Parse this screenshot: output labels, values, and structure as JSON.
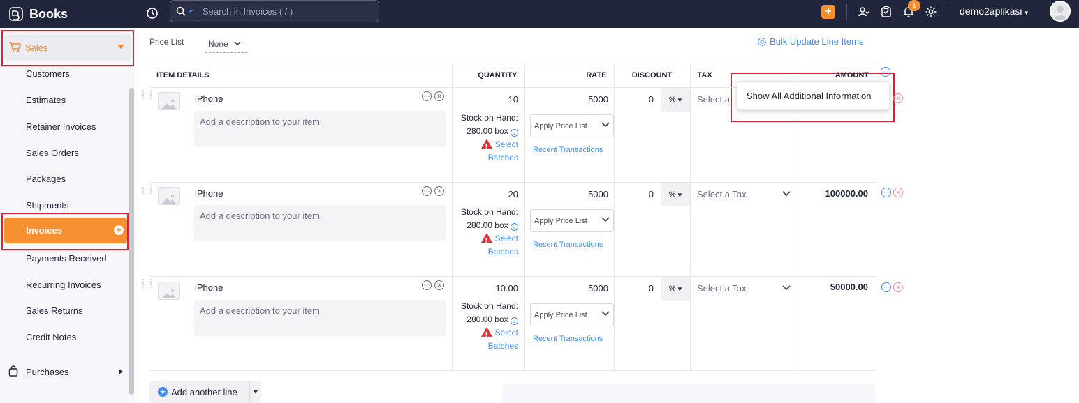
{
  "app": {
    "name": "Books"
  },
  "search": {
    "placeholder": "Search in Invoices ( / )"
  },
  "topbar": {
    "notification_count": "1",
    "org_name": "demo2aplikasi"
  },
  "sidebar": {
    "section": "Sales",
    "items": [
      "Customers",
      "Estimates",
      "Retainer Invoices",
      "Sales Orders",
      "Packages",
      "Shipments",
      "Invoices",
      "Payments Received",
      "Recurring Invoices",
      "Sales Returns",
      "Credit Notes"
    ],
    "active_item": "Invoices",
    "next_section": "Purchases"
  },
  "price_list": {
    "label": "Price List",
    "value": "None"
  },
  "bulk_update": {
    "label": "Bulk Update Line Items"
  },
  "table": {
    "headers": {
      "item": "ITEM DETAILS",
      "quantity": "QUANTITY",
      "rate": "RATE",
      "discount": "DISCOUNT",
      "tax": "TAX",
      "amount": "AMOUNT"
    }
  },
  "rows": [
    {
      "name": "iPhone",
      "description_placeholder": "Add a description to your item",
      "quantity": "10",
      "stock_label": "Stock on Hand:",
      "stock_value": "280.00 box",
      "select_batches": "Select Batches",
      "rate": "5000",
      "apply_price_list": "Apply Price List",
      "recent_transactions": "Recent Transactions",
      "discount": "0",
      "discount_unit": "%",
      "tax": "Select a Tax",
      "amount": ""
    },
    {
      "name": "iPhone",
      "description_placeholder": "Add a description to your item",
      "quantity": "20",
      "stock_label": "Stock on Hand:",
      "stock_value": "280.00 box",
      "select_batches": "Select Batches",
      "rate": "5000",
      "apply_price_list": "Apply Price List",
      "recent_transactions": "Recent Transactions",
      "discount": "0",
      "discount_unit": "%",
      "tax": "Select a Tax",
      "amount": "100000.00"
    },
    {
      "name": "iPhone",
      "description_placeholder": "Add a description to your item",
      "quantity": "10.00",
      "stock_label": "Stock on Hand:",
      "stock_value": "280.00 box",
      "select_batches": "Select Batches",
      "rate": "5000",
      "apply_price_list": "Apply Price List",
      "recent_transactions": "Recent Transactions",
      "discount": "0",
      "discount_unit": "%",
      "tax": "Select a Tax",
      "amount": "50000.00"
    }
  ],
  "row1_tax_partial": "Select a",
  "popover": {
    "label": "Show All Additional Information"
  },
  "add_line": {
    "label": "Add another line"
  },
  "colors": {
    "accent": "#f79030",
    "link": "#408dfb",
    "topbar": "#21263c",
    "highlight": "#e0202c"
  }
}
